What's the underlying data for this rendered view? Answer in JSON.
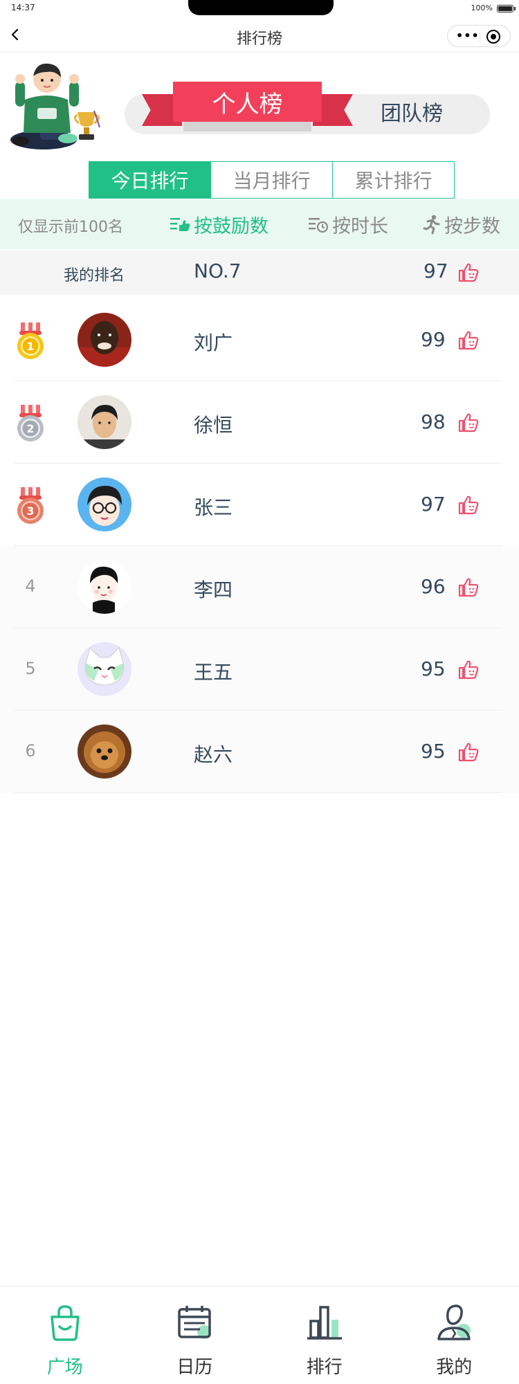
{
  "status_bar": {
    "time": "14:37",
    "battery": "100%"
  },
  "nav": {
    "title": "排行榜"
  },
  "board_switch": {
    "active": "个人榜",
    "inactive": "团队榜"
  },
  "time_tabs": [
    {
      "label": "今日排行",
      "active": true
    },
    {
      "label": "当月排行",
      "active": false
    },
    {
      "label": "累计排行",
      "active": false
    }
  ],
  "sort_bar": {
    "note": "仅显示前100名",
    "options": [
      {
        "label": "按鼓励数",
        "icon": "list-like-icon",
        "active": true
      },
      {
        "label": "按时长",
        "icon": "list-clock-icon",
        "active": false
      },
      {
        "label": "按步数",
        "icon": "runner-icon",
        "active": false
      }
    ]
  },
  "my_rank": {
    "label": "我的排名",
    "rank": "NO.7",
    "score": "97"
  },
  "rows": [
    {
      "rank": "1",
      "medal": "gold",
      "name": "刘广",
      "score": "99",
      "avatar": "man-dark-avatar"
    },
    {
      "rank": "2",
      "medal": "silver",
      "name": "徐恒",
      "score": "98",
      "avatar": "man-photo-avatar"
    },
    {
      "rank": "3",
      "medal": "bronze",
      "name": "张三",
      "score": "97",
      "avatar": "glasses-cartoon-avatar"
    },
    {
      "rank": "4",
      "medal": "",
      "name": "李四",
      "score": "96",
      "avatar": "boy-cartoon-avatar"
    },
    {
      "rank": "5",
      "medal": "",
      "name": "王五",
      "score": "95",
      "avatar": "cat-cartoon-avatar"
    },
    {
      "rank": "6",
      "medal": "",
      "name": "赵六",
      "score": "95",
      "avatar": "dog-photo-avatar"
    }
  ],
  "tab_bar": [
    {
      "label": "广场",
      "icon": "bag-icon",
      "active": true
    },
    {
      "label": "日历",
      "icon": "calendar-icon",
      "active": false
    },
    {
      "label": "排行",
      "icon": "bar-chart-icon",
      "active": false
    },
    {
      "label": "我的",
      "icon": "user-icon",
      "active": false
    }
  ],
  "colors": {
    "accent": "#21c086",
    "ribbon": "#f2405a",
    "like": "#f0506e",
    "text": "#34495e"
  }
}
